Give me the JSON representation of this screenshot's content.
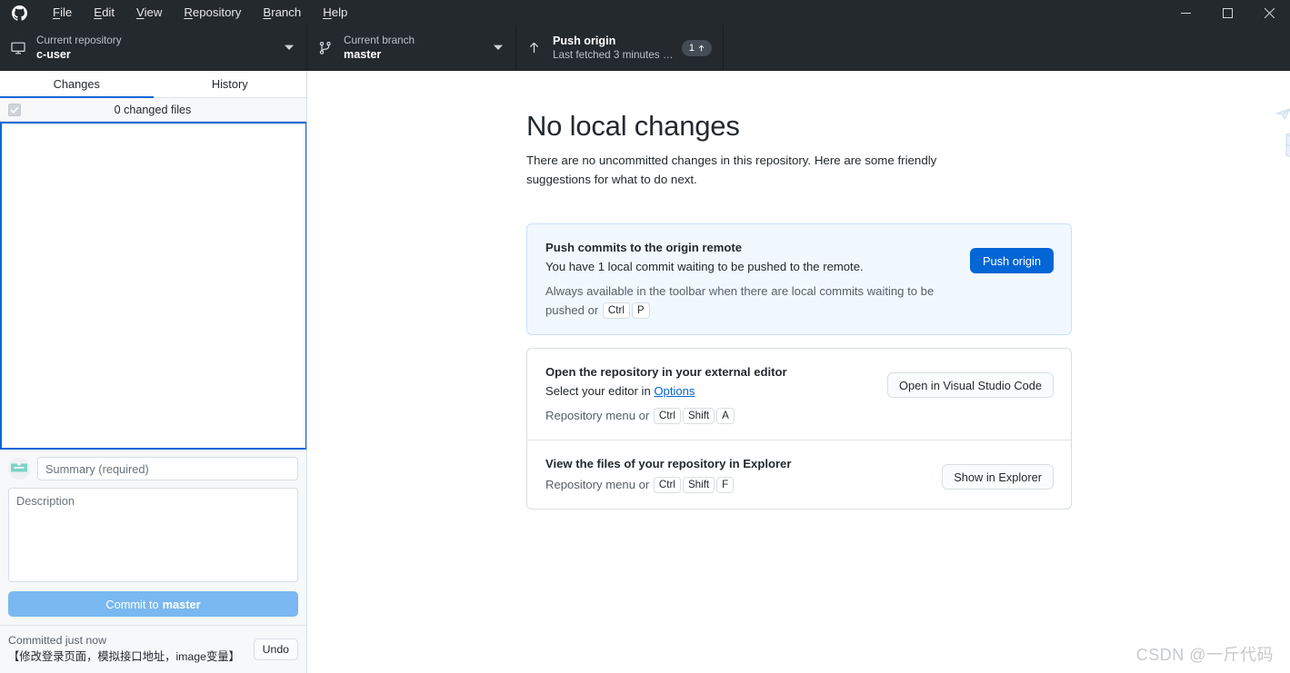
{
  "titlebar": {
    "logo_icon": "github-mark-icon",
    "menus": [
      {
        "label": "File",
        "accel": "F"
      },
      {
        "label": "Edit",
        "accel": "E"
      },
      {
        "label": "View",
        "accel": "V"
      },
      {
        "label": "Repository",
        "accel": "R"
      },
      {
        "label": "Branch",
        "accel": "B"
      },
      {
        "label": "Help",
        "accel": "H"
      }
    ],
    "window_controls": {
      "minimize": "minimize-icon",
      "maximize": "maximize-icon",
      "close": "close-icon"
    }
  },
  "toolbar": {
    "repository": {
      "icon": "repository-desktop-icon",
      "label": "Current repository",
      "value": "c-user",
      "caret": "chevron-down-icon"
    },
    "branch": {
      "icon": "git-branch-icon",
      "label": "Current branch",
      "value": "master",
      "caret": "chevron-down-icon"
    },
    "push": {
      "icon": "arrow-up-icon",
      "title": "Push origin",
      "subtitle": "Last fetched 3 minutes a...",
      "badge_count": "1",
      "badge_icon": "arrow-up-icon"
    }
  },
  "sidebar": {
    "tabs": [
      {
        "label": "Changes",
        "active": true
      },
      {
        "label": "History",
        "active": false
      }
    ],
    "changed_files": {
      "checkbox_state": "checked-disabled",
      "text": "0 changed files"
    },
    "commit": {
      "avatar_icon": "user-identicon-avatar",
      "summary_placeholder": "Summary (required)",
      "summary_value": "",
      "description_placeholder": "Description",
      "description_value": "",
      "button_prefix": "Commit to ",
      "button_branch": "master"
    },
    "undo": {
      "status": "Committed just now",
      "message": "【修改登录页面，模拟接口地址，image变量】",
      "button_label": "Undo"
    }
  },
  "main": {
    "heading": "No local changes",
    "blurb": "There are no uncommitted changes in this repository. Here are some friendly suggestions for what to do next.",
    "illustration_icon": "boxes-paper-planes-illustration",
    "cards": [
      {
        "title": "Push commits to the origin remote",
        "desc": "You have 1 local commit waiting to be pushed to the remote.",
        "hint_prefix": "Always available in the toolbar when there are local commits waiting to be pushed or ",
        "keys": [
          "Ctrl",
          "P"
        ],
        "hint_suffix": "",
        "button": "Push origin",
        "button_style": "primary"
      },
      {
        "title": "Open the repository in your external editor",
        "desc_prefix": "Select your editor in ",
        "desc_link": "Options",
        "hint_prefix": "Repository menu or ",
        "keys": [
          "Ctrl",
          "Shift",
          "A"
        ],
        "button": "Open in Visual Studio Code",
        "button_style": "default"
      },
      {
        "title": "View the files of your repository in Explorer",
        "hint_prefix": "Repository menu or ",
        "keys": [
          "Ctrl",
          "Shift",
          "F"
        ],
        "button": "Show in Explorer",
        "button_style": "default"
      }
    ]
  },
  "watermark": "CSDN @一斤代码",
  "colors": {
    "titlebar_bg": "#24292e",
    "accent_blue": "#0366d6",
    "highlight_card_bg": "#f1f8ff",
    "sidebar_bg": "#f6f8fa",
    "commit_button": "#79b8f0",
    "avatar_teal": "#79d3c6"
  }
}
